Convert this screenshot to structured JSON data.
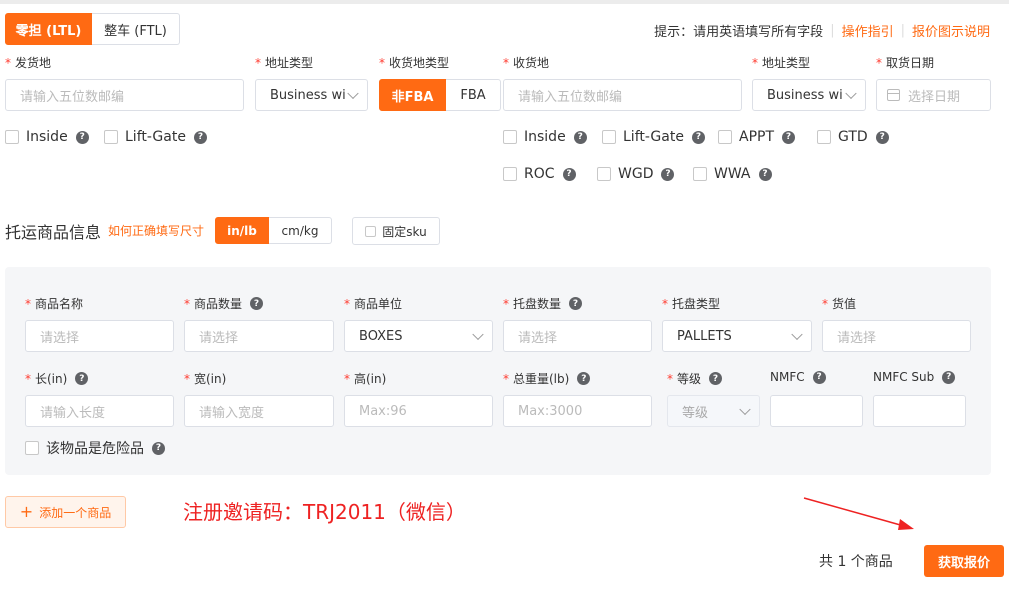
{
  "mode_tabs": [
    {
      "label": "零担 (LTL)",
      "active": true
    },
    {
      "label": "整车 (FTL)",
      "active": false
    }
  ],
  "header": {
    "hint": "提示：请用英语填写所有字段",
    "guide_link": "操作指引",
    "quote_link": "报价图示说明"
  },
  "origin": {
    "label": "发货地",
    "placeholder": "请输入五位数邮编",
    "addr_type_label": "地址类型",
    "addr_type_value": "Business wi",
    "options": [
      "Inside",
      "Lift-Gate"
    ]
  },
  "dest_type": {
    "label": "收货地类型",
    "options": [
      {
        "label": "非FBA",
        "active": true
      },
      {
        "label": "FBA",
        "active": false
      }
    ]
  },
  "destination": {
    "label": "收货地",
    "placeholder": "请输入五位数邮编",
    "addr_type_label": "地址类型",
    "addr_type_value": "Business wi",
    "date_label": "取货日期",
    "date_placeholder": "选择日期",
    "options_row1": [
      "Inside",
      "Lift-Gate",
      "APPT",
      "GTD"
    ],
    "options_row2": [
      "ROC",
      "WGD",
      "WWA"
    ]
  },
  "goods_section": {
    "title": "托运商品信息",
    "size_help": "如何正确填写尺寸",
    "units": [
      {
        "label": "in/lb",
        "active": true
      },
      {
        "label": "cm/kg",
        "active": false
      }
    ],
    "fixed_sku": "固定sku"
  },
  "item": {
    "name": {
      "label": "商品名称",
      "placeholder": "请选择"
    },
    "qty": {
      "label": "商品数量",
      "placeholder": "请选择"
    },
    "unit": {
      "label": "商品单位",
      "value": "BOXES"
    },
    "pallet_qty": {
      "label": "托盘数量",
      "placeholder": "请选择"
    },
    "pallet_type": {
      "label": "托盘类型",
      "value": "PALLETS"
    },
    "value": {
      "label": "货值",
      "placeholder": "请选择"
    },
    "length": {
      "label": "长(in)",
      "placeholder": "请输入长度"
    },
    "width": {
      "label": "宽(in)",
      "placeholder": "请输入宽度"
    },
    "height": {
      "label": "高(in)",
      "placeholder": "Max:96"
    },
    "weight": {
      "label": "总重量(lb)",
      "placeholder": "Max:3000"
    },
    "grade": {
      "label": "等级",
      "placeholder": "等级"
    },
    "nmfc": {
      "label": "NMFC",
      "value": ""
    },
    "nmfc_sub": {
      "label": "NMFC Sub",
      "value": ""
    },
    "hazmat": "该物品是危险品"
  },
  "footer": {
    "add_item": "添加一个商品",
    "invite": "注册邀请码：TRJ2011（微信）",
    "count": "共 1 个商品",
    "get_quote": "获取报价"
  },
  "colors": {
    "accent": "#ff6a13",
    "invite_red": "#ee2222",
    "panel_bg": "#f5f6f8"
  }
}
